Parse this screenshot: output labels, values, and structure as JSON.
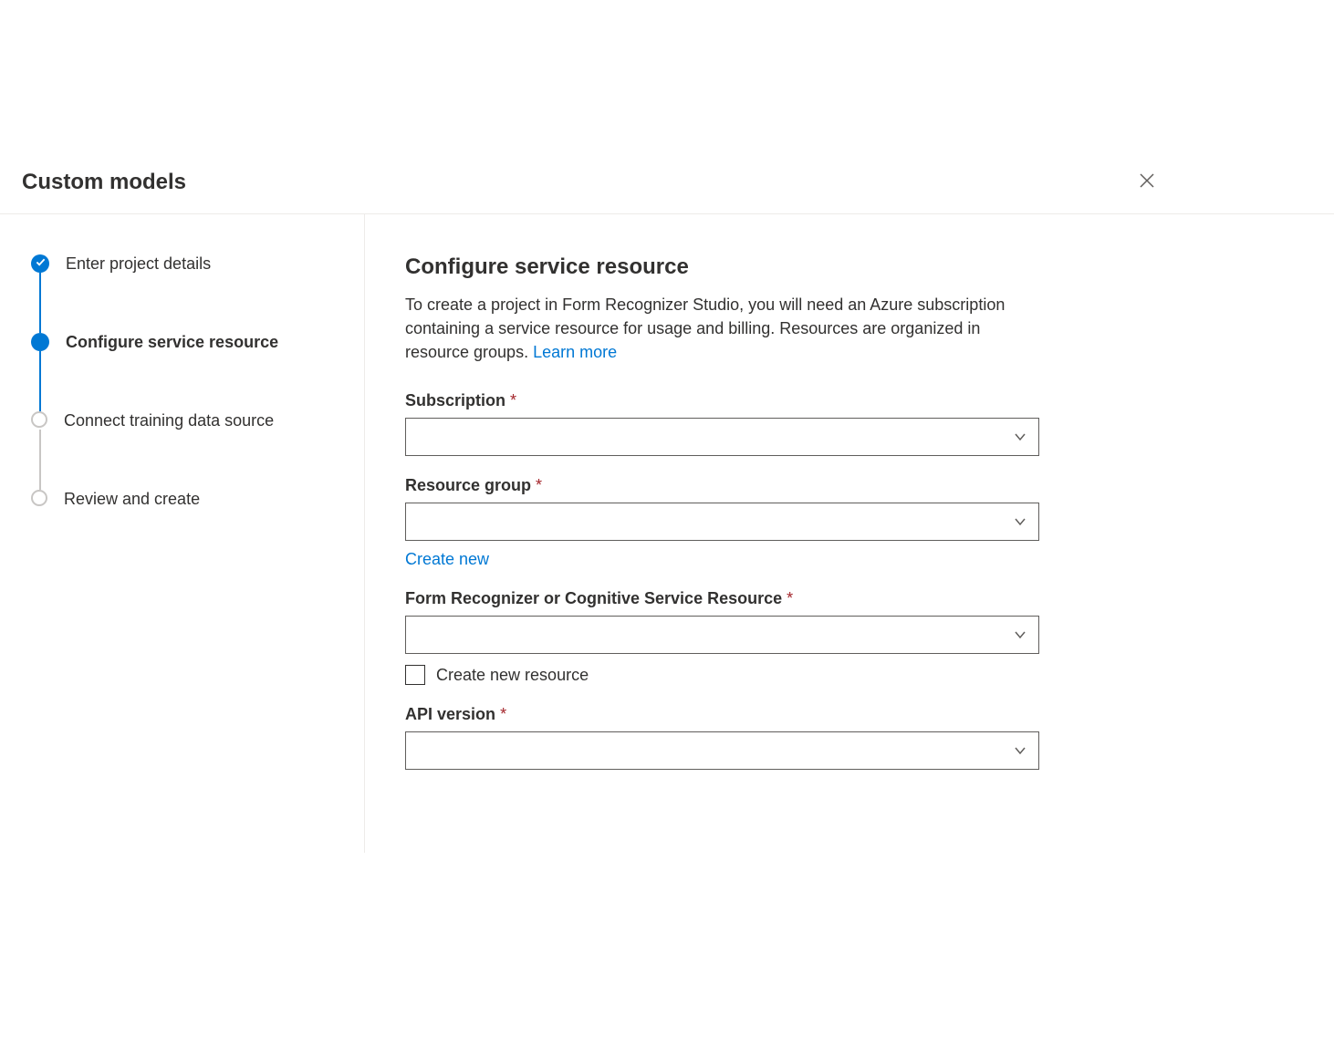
{
  "header": {
    "title": "Custom models"
  },
  "steps": [
    {
      "label": "Enter project details",
      "state": "completed"
    },
    {
      "label": "Configure service resource",
      "state": "current"
    },
    {
      "label": "Connect training data source",
      "state": "pending"
    },
    {
      "label": "Review and create",
      "state": "pending"
    }
  ],
  "main": {
    "title": "Configure service resource",
    "description": "To create a project in Form Recognizer Studio, you will need an Azure subscription containing a service resource for usage and billing. Resources are organized in resource groups. ",
    "learn_more": "Learn more"
  },
  "form": {
    "subscription": {
      "label": "Subscription",
      "value": ""
    },
    "resource_group": {
      "label": "Resource group",
      "value": "",
      "create_new": "Create new"
    },
    "service_resource": {
      "label": "Form Recognizer or Cognitive Service Resource",
      "value": "",
      "checkbox_label": "Create new resource"
    },
    "api_version": {
      "label": "API version",
      "value": ""
    }
  }
}
